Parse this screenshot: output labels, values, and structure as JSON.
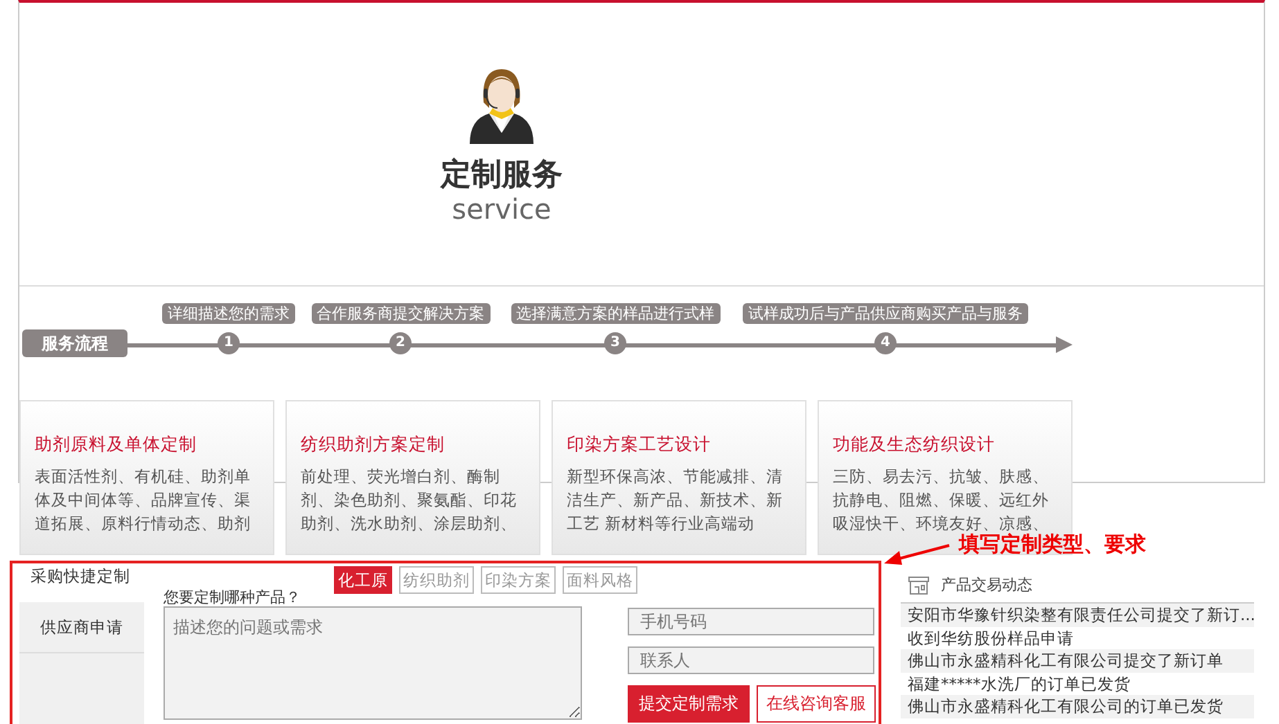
{
  "hero": {
    "title": "定制服务",
    "subtitle": "service"
  },
  "process": {
    "label": "服务流程",
    "steps": [
      {
        "number": "1",
        "caption": "详细描述您的需求"
      },
      {
        "number": "2",
        "caption": "合作服务商提交解决方案"
      },
      {
        "number": "3",
        "caption": "选择满意方案的样品进行式样"
      },
      {
        "number": "4",
        "caption": "试样成功后与产品供应商购买产品与服务"
      }
    ]
  },
  "cards": [
    {
      "title": "助剂原料及单体定制",
      "body": "表面活性剂、有机硅、助剂单体及中间体等、品牌宣传、渠道拓展、原料行情动态、助剂"
    },
    {
      "title": "纺织助剂方案定制",
      "body": "前处理、荧光增白剂、酶制剂、染色助剂、聚氨酯、印花助剂、洗水助剂、涂层助剂、"
    },
    {
      "title": "印染方案工艺设计",
      "body": "新型环保高浓、节能减排、清洁生产、新产品、新技术、新工艺 新材料等行业高端动"
    },
    {
      "title": "功能及生态纺织设计",
      "body": "三防、易去污、抗皱、肤感、抗静电、阻燃、保暖、远红外吸湿快干、环境友好、凉感、"
    }
  ],
  "form": {
    "tabs": [
      {
        "label": "采购快捷定制",
        "selected": true
      },
      {
        "label": "供应商申请",
        "selected": false
      }
    ],
    "question": "您要定制哪种产品？",
    "categories": [
      {
        "label": "化工原",
        "selected": true
      },
      {
        "label": "纺织助剂",
        "selected": false
      },
      {
        "label": "印染方案",
        "selected": false
      },
      {
        "label": "面料风格",
        "selected": false
      }
    ],
    "description": {
      "placeholder": "描述您的问题或需求"
    },
    "phone": {
      "placeholder": "手机号码"
    },
    "contact": {
      "placeholder": "联系人"
    },
    "buttons": [
      {
        "label": "提交定制需求",
        "kind": "primary"
      },
      {
        "label": "在线咨询客服",
        "kind": "outline"
      }
    ]
  },
  "annotation": "填写定制类型、要求",
  "news": {
    "title": "产品交易动态",
    "items": [
      "安阳市华豫针织染整有限责任公司提交了新订...",
      "收到华纺股份样品申请",
      "佛山市永盛精科化工有限公司提交了新订单",
      "福建*****水洗厂的订单已发货",
      "佛山市永盛精科化工有限公司的订单已发货"
    ]
  }
}
